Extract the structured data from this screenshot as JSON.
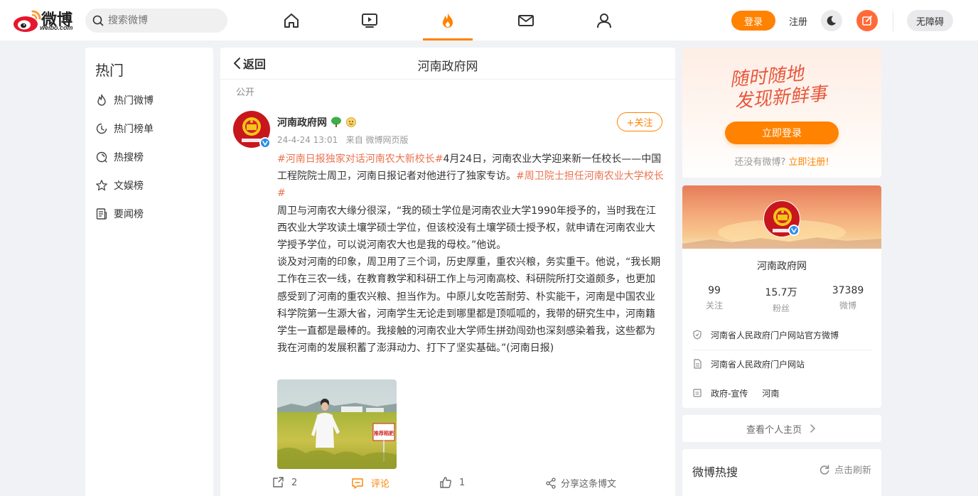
{
  "colors": {
    "accent": "#ff8200",
    "hashtag": "#eb7350",
    "verified": "#2d8ee8",
    "page_bg": "#f1f2f5"
  },
  "header": {
    "logo_text": "微博",
    "logo_sub": "weibo.com",
    "search_placeholder": "搜索微博",
    "nav_icons": [
      "home-icon",
      "video-icon",
      "hot-icon",
      "mail-icon",
      "profile-icon"
    ],
    "login_label": "登录",
    "register_label": "注册",
    "accessibility_label": "无障碍"
  },
  "left_nav": {
    "title": "热门",
    "items": [
      {
        "label": "热门微博",
        "icon": "flame-icon"
      },
      {
        "label": "热门榜单",
        "icon": "clock-icon"
      },
      {
        "label": "热搜榜",
        "icon": "search-ring-icon"
      },
      {
        "label": "文娱榜",
        "icon": "star-icon"
      },
      {
        "label": "要闻榜",
        "icon": "news-icon"
      }
    ]
  },
  "post_page": {
    "back_label": "返回",
    "title": "河南政府网",
    "visibility": "公开",
    "author": "河南政府网",
    "time": "24-4-24 13:01",
    "source": "来自 微博网页版",
    "follow_label": "+关注",
    "hashtag1": "#河南日报独家对话河南农大新校长#",
    "text1": "4月24日，河南农业大学迎来新一任校长——中国工程院院士周卫，河南日报记者对他进行了独家专访。",
    "hashtag2": "#周卫院士担任河南农业大学校长#",
    "para2": "周卫与河南农大缘分很深，“我的硕士学位是河南农业大学1990年授予的，当时我在江西农业大学攻读土壤学硕士学位，但该校没有土壤学硕士授予权，就申请在河南农业大学授予学位，可以说河南农大也是我的母校。”他说。",
    "para3": "谈及对河南的印象，周卫用了三个词，历史厚重，重农兴粮，务实重干。他说，“我长期工作在三农一线，在教育教学和科研工作上与河南高校、科研院所打交道颇多，也更加感受到了河南的重农兴粮、担当作为。中原儿女吃苦耐劳、朴实能干，河南是中国农业科学院第一生源大省，河南学生无论走到哪里都是顶呱呱的，我带的研究生中，河南籍学生一直都是最棒的。我接触的河南农业大学师生拼劲闯劲也深刻感染着我，这些都为我在河南的发展积蓄了澎湃动力、打下了坚实基础。”(河南日报)",
    "photo_sign": "推荐稻肥",
    "repost_count": "2",
    "comment_label": "评论",
    "like_count": "1",
    "share_label": "分享这条博文"
  },
  "promo": {
    "slogan_line1": "随时随地",
    "slogan_line2": "发现新鲜事",
    "login_button": "立即登录",
    "reg_prompt": "还没有微博?",
    "reg_link": "立即注册!"
  },
  "profile": {
    "name": "河南政府网",
    "stats": [
      {
        "num": "99",
        "label": "关注"
      },
      {
        "num": "15.7万",
        "label": "粉丝"
      },
      {
        "num": "37389",
        "label": "微博"
      }
    ],
    "verified_desc": "河南省人民政府门户网站官方微博",
    "intro": "河南省人民政府门户网站",
    "tag": "政府-宣传",
    "location": "河南"
  },
  "view_home_label": "查看个人主页",
  "hot_search": {
    "title": "微博热搜",
    "refresh_label": "点击刷新"
  }
}
